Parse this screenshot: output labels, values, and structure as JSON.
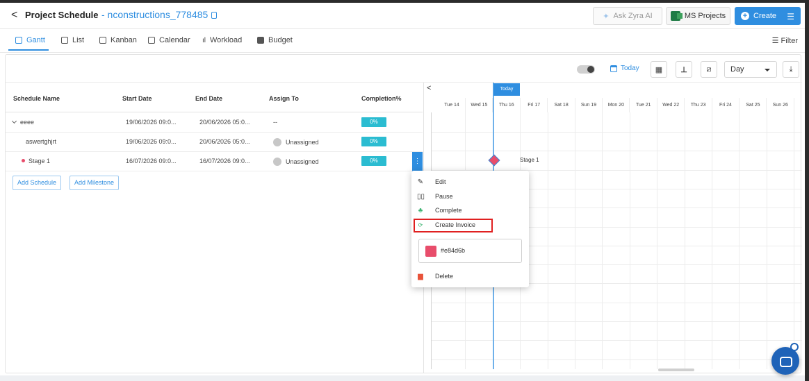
{
  "header": {
    "back_label": "<",
    "title": "Project Schedule",
    "project_name": "- nconstructions_778485",
    "ask_label": "Ask Zyra AI",
    "ms_label": "MS Projects",
    "create_label": "Create"
  },
  "tabs": [
    {
      "label": "Gantt"
    },
    {
      "label": "List"
    },
    {
      "label": "Kanban"
    },
    {
      "label": "Calendar"
    },
    {
      "label": "Workload"
    },
    {
      "label": "Budget"
    }
  ],
  "filter_label": "Filter",
  "toolbar": {
    "today_label": "Today",
    "view_select": "Day"
  },
  "table": {
    "headers": [
      "Schedule Name",
      "Start Date",
      "End Date",
      "Assign To",
      "Completion%"
    ],
    "rows": [
      {
        "name": "eeee",
        "start": "19/06/2026 09:0...",
        "end": "20/06/2026 05:0...",
        "assign": "--",
        "completion": "0%"
      },
      {
        "name": "aswertghjrt",
        "start": "19/06/2026 09:0...",
        "end": "20/06/2026 05:0...",
        "assign": "Unassigned",
        "completion": "0%"
      },
      {
        "name": "Stage 1",
        "start": "16/07/2026 09:0...",
        "end": "16/07/2026 09:0...",
        "assign": "Unassigned",
        "completion": "0%"
      }
    ],
    "add_schedule": "Add Schedule",
    "add_milestone": "Add Milestone"
  },
  "gantt": {
    "nav_label": "<",
    "today_marker": "Today",
    "days": [
      "Tue 14",
      "Wed 15",
      "Thu 16",
      "Fri 17",
      "Sat 18",
      "Sun 19",
      "Mon 20",
      "Tue 21",
      "Wed 22",
      "Thu 23",
      "Fri 24",
      "Sat 25",
      "Sun 26",
      "Mo"
    ],
    "milestone_label": "Stage 1"
  },
  "context_menu": {
    "items": [
      {
        "label": "Edit",
        "icon": "pencil-icon"
      },
      {
        "label": "Pause",
        "icon": "pause-icon"
      },
      {
        "label": "Complete",
        "icon": "thumbs-up-icon"
      },
      {
        "label": "Create Invoice",
        "icon": "invoice-icon"
      }
    ],
    "color_value": "#e84d6b",
    "delete_label": "Delete"
  },
  "colors": {
    "accent": "#2f8ee0",
    "completion": "#2bbcd1",
    "milestone": "#e84d6b",
    "highlight": "#e02020"
  }
}
